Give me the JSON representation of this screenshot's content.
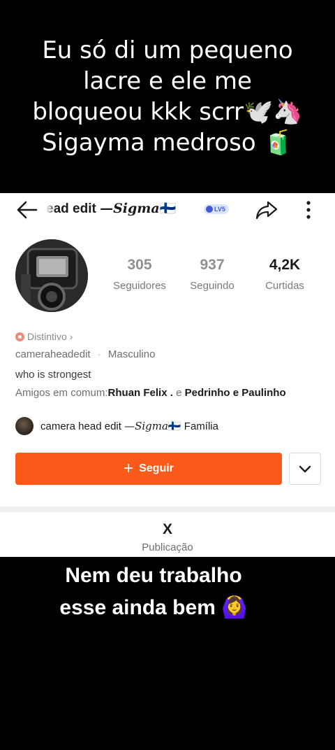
{
  "overlay_top": {
    "lines": [
      "Eu só di um pequeno",
      "lacre e ele me",
      "bloqueou kkk scrr🕊️🦄",
      "Sigayma medroso 🧃"
    ]
  },
  "navbar": {
    "title_prefix": "ead edit ",
    "title_sigma": "—Sigma",
    "title_flag": "🇫🇮",
    "level_badge": "LV5",
    "icons": [
      "back-arrow-icon",
      "share-icon",
      "more-vertical-icon"
    ]
  },
  "profile": {
    "stats": [
      {
        "value": "305",
        "label": "Seguidores"
      },
      {
        "value": "937",
        "label": "Seguindo"
      },
      {
        "value": "4,2K",
        "label": "Curtidas"
      }
    ],
    "badge_label": "Distintivo ›",
    "username": "cameraheadedit",
    "separator": "·",
    "gender": "Masculino",
    "bio": "who is strongest",
    "friends_prefix": "Amigos em comum:",
    "friend1": "Rhuan Felix .",
    "friends_conj": " e ",
    "friend2": "Pedrinho e Paulinho",
    "family_name_prefix": "camera head edit ",
    "family_sigma": "—Sigma",
    "family_flag": "🇫🇮",
    "family_suffix": " Família",
    "follow_label": "Seguir",
    "posts_count": "X",
    "posts_label": "Publicação"
  },
  "overlay_bottom": {
    "lines": [
      "Nem deu trabalho",
      "esse ainda bem 🙆‍♀️"
    ]
  },
  "colors": {
    "accent": "#fb5a1a",
    "badge_blue": "#3d5ad6"
  }
}
